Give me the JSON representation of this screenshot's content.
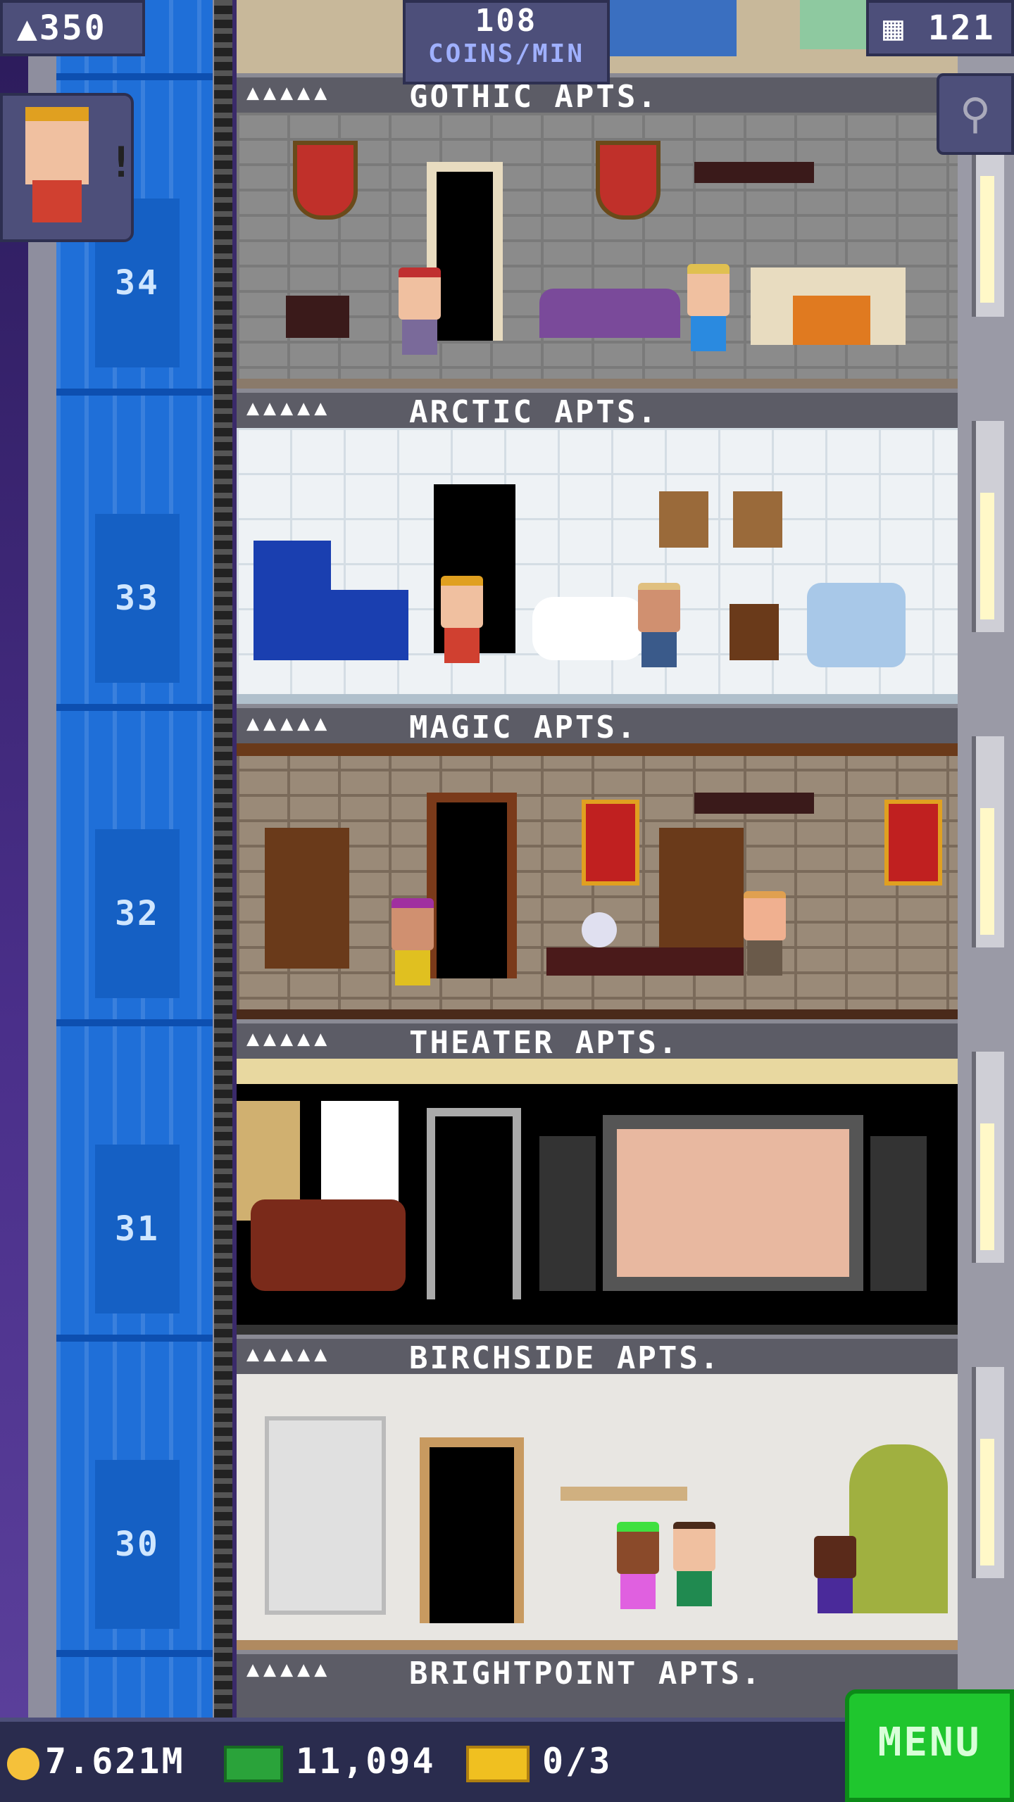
{
  "hud": {
    "population": "350",
    "coins_rate_value": "108",
    "coins_rate_label": "COINS/MIN",
    "floors": "121"
  },
  "floors": [
    {
      "number": "34",
      "name": "GOTHIC APTS.",
      "stars": "▲▲▲▲▲"
    },
    {
      "number": "33",
      "name": "ARCTIC APTS.",
      "stars": "▲▲▲▲▲"
    },
    {
      "number": "32",
      "name": "MAGIC APTS.",
      "stars": "▲▲▲▲▲"
    },
    {
      "number": "31",
      "name": "THEATER APTS.",
      "stars": "▲▲▲▲▲"
    },
    {
      "number": "30",
      "name": "BIRCHSIDE APTS.",
      "stars": "▲▲▲▲▲"
    }
  ],
  "next_floor_name": "BRIGHTPOINT APTS.",
  "bottom": {
    "coins": "7.621M",
    "bux": "11,094",
    "tickets": "0/3",
    "menu_label": "MENU"
  },
  "colors": {
    "elevator": "#1f6fd8",
    "menu": "#1fc62e",
    "hud": "#4d4f7a"
  }
}
